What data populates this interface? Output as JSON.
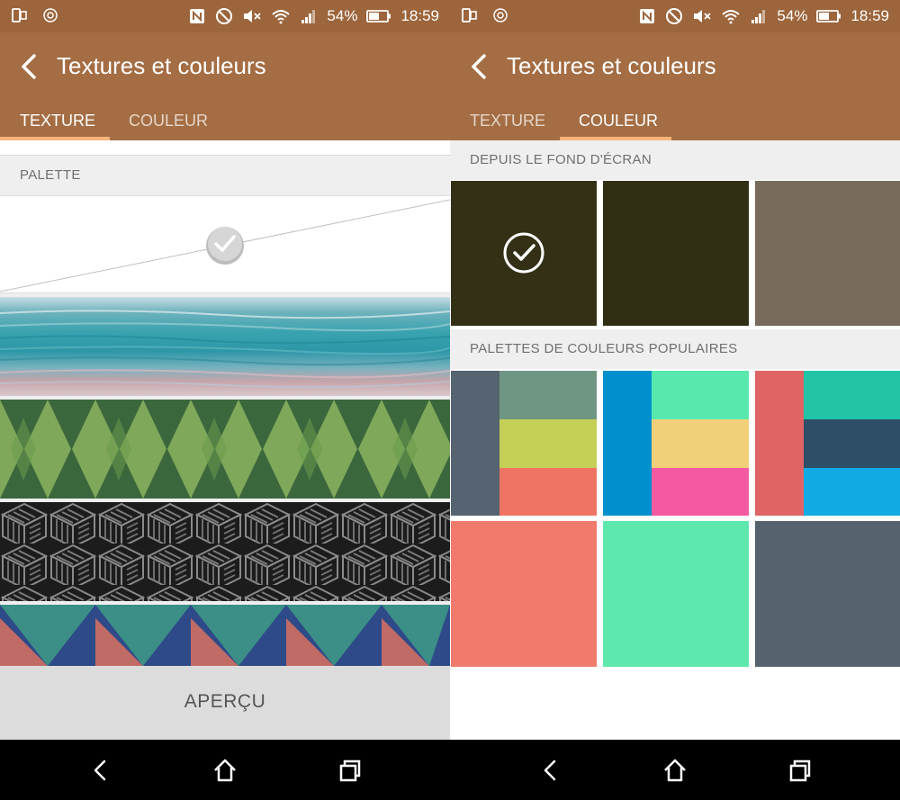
{
  "status_bar": {
    "battery": "54%",
    "time": "18:59"
  },
  "app": {
    "title": "Textures et couleurs",
    "tabs": [
      {
        "label": "TEXTURE"
      },
      {
        "label": "COULEUR"
      }
    ]
  },
  "left_screen": {
    "active_tab": "TEXTURE",
    "section_palette": "PALETTE",
    "textures": [
      {
        "name": "blank",
        "selected": true
      },
      {
        "name": "teal-waves",
        "selected": false
      },
      {
        "name": "green-diamonds",
        "selected": false
      },
      {
        "name": "black-cubes",
        "selected": false
      },
      {
        "name": "colored-triangles",
        "selected": false
      }
    ],
    "preview_button": "APERÇU"
  },
  "right_screen": {
    "active_tab": "COULEUR",
    "section_wallpaper": "DEPUIS LE FOND D'ÉCRAN",
    "wallpaper_colors": [
      {
        "color": "#343016",
        "selected": true
      },
      {
        "color": "#302e13",
        "selected": false
      },
      {
        "color": "#786a5d",
        "selected": false
      }
    ],
    "section_popular": "PALETTES DE COULEURS POPULAIRES",
    "popular_palettes": [
      {
        "colors": [
          "#566370",
          "#6f9682",
          "#c4cf55",
          "#f07463"
        ]
      },
      {
        "colors": [
          "#0190cd",
          "#58e8ad",
          "#f2d07a",
          "#f35aa0"
        ]
      },
      {
        "colors": [
          "#e06464",
          "#22c4a8",
          "#2d4e66",
          "#12aae2"
        ]
      },
      {
        "colors": [
          "#f07a6b"
        ]
      },
      {
        "colors": [
          "#5ee8ad"
        ]
      },
      {
        "colors": [
          "#56636e"
        ]
      }
    ]
  },
  "theme": {
    "statusbar_bg": "#9c653c",
    "appbar_bg": "#a46d43",
    "tab_indicator": "#f6b47c"
  },
  "icons": {
    "status_left": [
      "screen-mirror-icon",
      "htc-logo-icon"
    ],
    "status_right": [
      "nfc-icon",
      "do-not-disturb-icon",
      "volume-mute-icon",
      "wifi-icon",
      "signal-icon",
      "battery-icon"
    ],
    "nav": [
      "nav-back-icon",
      "nav-home-icon",
      "nav-recent-icon"
    ]
  }
}
